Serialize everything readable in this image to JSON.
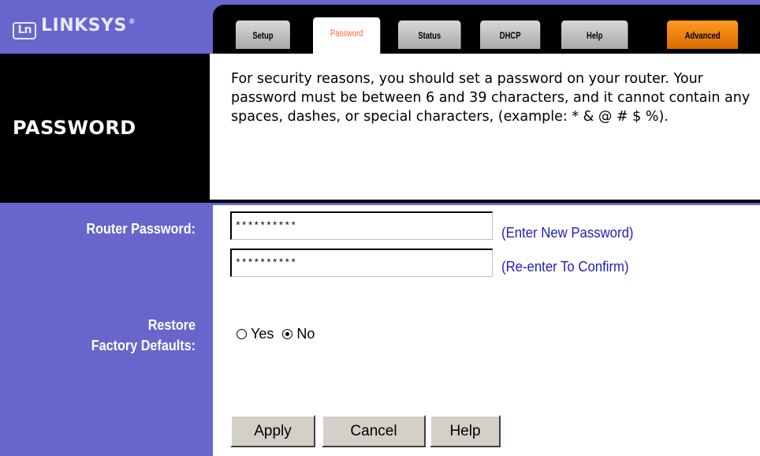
{
  "brand": {
    "name": "LINKSYS",
    "reg_mark": "®",
    "logo_glyph": "Ln"
  },
  "tabs": [
    {
      "label": "Setup",
      "active": false
    },
    {
      "label": "Password",
      "active": true
    },
    {
      "label": "Status",
      "active": false
    },
    {
      "label": "DHCP",
      "active": false
    },
    {
      "label": "Help",
      "active": false
    },
    {
      "label": "Advanced",
      "active": false
    }
  ],
  "page": {
    "title": "PASSWORD",
    "description": "For security reasons, you should set a password on your router. Your password must be between 6 and 39 characters, and it cannot contain any spaces, dashes, or special characters, (example: * & @ # $ %)."
  },
  "form": {
    "password_label": "Router Password:",
    "password_value": "**********",
    "password_hint": "(Enter New Password)",
    "confirm_value": "**********",
    "confirm_hint": "(Re-enter To Confirm)",
    "restore_label_line1": "Restore",
    "restore_label_line2": "Factory Defaults:",
    "restore_options": [
      {
        "label": "Yes",
        "checked": false
      },
      {
        "label": "No",
        "checked": true
      }
    ]
  },
  "buttons": {
    "apply": "Apply",
    "cancel": "Cancel",
    "help": "Help"
  },
  "colors": {
    "purple": "#6666cc",
    "black": "#000000",
    "tab_orange": "#ff6633",
    "advanced_orange": "#ee8811",
    "hint_blue": "#1f1fb8",
    "button_gray": "#d4d0c8"
  },
  "icons": {
    "radio_checked": "radio-selected-icon",
    "radio_unchecked": "radio-empty-icon"
  }
}
